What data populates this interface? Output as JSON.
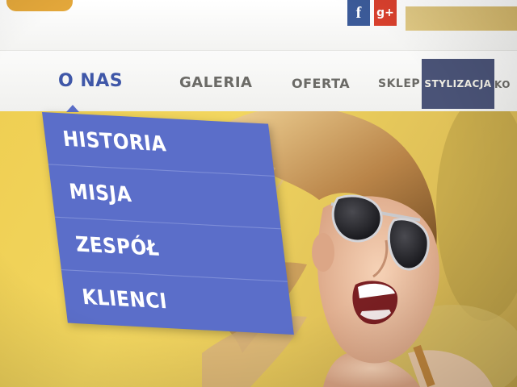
{
  "social": {
    "facebook_glyph": "f",
    "googleplus_glyph": "g+"
  },
  "nav": {
    "items": [
      {
        "label": "O NAS"
      },
      {
        "label": "GALERIA"
      },
      {
        "label": "OFERTA"
      },
      {
        "label": "SKLEP"
      },
      {
        "label": "STYLIZACJA"
      },
      {
        "label": "KO"
      }
    ]
  },
  "dropdown": {
    "items": [
      {
        "label": "HISTORIA"
      },
      {
        "label": "MISJA"
      },
      {
        "label": "ZESPÓŁ"
      },
      {
        "label": "KLIENCI"
      }
    ]
  },
  "colors": {
    "accent_blue": "#5b6ec9",
    "active_nav": "#3f57a8",
    "highlight_nav": "#4a5377",
    "hero_yellow": "#efcf53",
    "facebook": "#3b5a98",
    "googleplus": "#d8402d"
  },
  "icons": [
    "facebook-icon",
    "google-plus-icon"
  ]
}
